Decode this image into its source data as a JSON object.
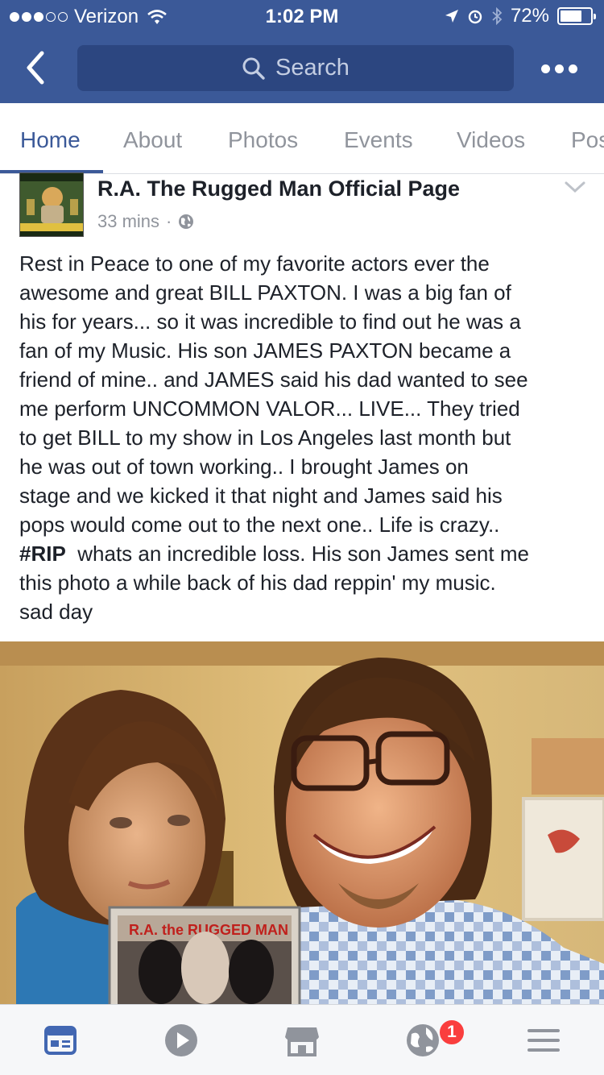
{
  "status_bar": {
    "carrier": "Verizon",
    "time": "1:02 PM",
    "battery": "72%",
    "battery_level": 0.72,
    "signal_bars": 3,
    "icons": [
      "wifi-icon",
      "location-arrow-icon",
      "alarm-icon",
      "bluetooth-icon",
      "battery-icon"
    ]
  },
  "nav": {
    "search_placeholder": "Search",
    "icons": [
      "back-chevron-icon",
      "search-icon",
      "more-dots-icon"
    ]
  },
  "tabs": [
    {
      "label": "Home",
      "active": true
    },
    {
      "label": "About",
      "active": false
    },
    {
      "label": "Photos",
      "active": false
    },
    {
      "label": "Events",
      "active": false
    },
    {
      "label": "Videos",
      "active": false
    },
    {
      "label": "Pos",
      "active": false
    }
  ],
  "post": {
    "page_name": "R.A. The Rugged Man Official Page",
    "time": "33 mins",
    "separator": "·",
    "privacy_icon": "globe-icon",
    "text_lines": [
      "Rest in Peace to one of my favorite actors ever the",
      "awesome and great BILL PAXTON. I was a big fan of",
      "his for years... so it was incredible to find out he was a",
      "fan of my Music. His son JAMES PAXTON became a",
      "friend of mine.. and JAMES said his dad wanted to see",
      "me perform UNCOMMON VALOR... LIVE... They tried",
      "to get BILL to my show in Los Angeles last month but",
      "he was out of town working.. I brought James on",
      "stage and we kicked it that night and James said his",
      "pops would come out to the next one.. Life is crazy.."
    ],
    "hashtag": "#RIP",
    "hashtag_line_rest": "  whats an incredible loss. His son James sent me",
    "text_lines_after": [
      "this photo a while back of his dad reppin' my music.",
      "sad day"
    ],
    "cd_title": "R.A. the RUGGED MAN"
  },
  "bottom_bar": {
    "items": [
      "news-feed-icon",
      "video-play-icon",
      "marketplace-icon",
      "notifications-globe-icon",
      "menu-icon"
    ],
    "badge_count": "1"
  },
  "colors": {
    "brand": "#3b5998",
    "search_bg": "#2c4680",
    "text": "#1d2129",
    "muted": "#90949c",
    "badge": "#fa3e3e"
  }
}
